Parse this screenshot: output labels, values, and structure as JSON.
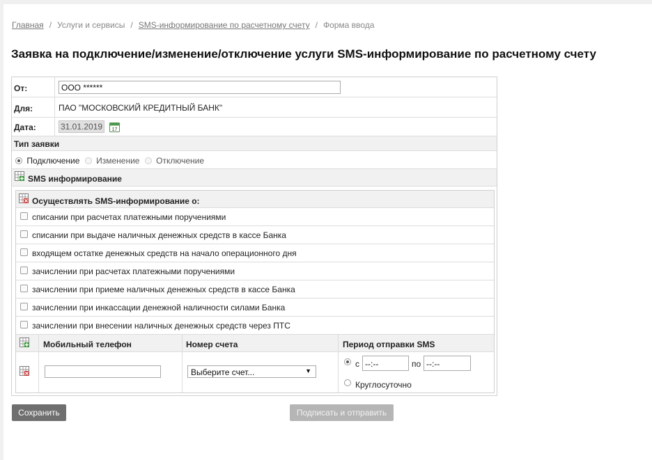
{
  "breadcrumb": {
    "home": "Главная",
    "services": "Услуги и сервисы",
    "sms": "SMS-информирование по расчетному счету",
    "current": "Форма ввода"
  },
  "title": "Заявка на подключение/изменение/отключение услуги SMS-информирование по расчетному счету",
  "from": {
    "label": "От:",
    "value": "ООО  ******"
  },
  "to": {
    "label": "Для:",
    "value": "ПАО \"МОСКОВСКИЙ КРЕДИТНЫЙ БАНК\""
  },
  "date": {
    "label": "Дата:",
    "value": "31.01.2019",
    "icon": "calendar-icon"
  },
  "request_type": {
    "heading": "Тип заявки",
    "options": [
      {
        "label": "Подключение",
        "selected": true
      },
      {
        "label": "Изменение",
        "selected": false
      },
      {
        "label": "Отключение",
        "selected": false
      }
    ]
  },
  "sms": {
    "heading": "SMS информирование",
    "notify_heading": "Осуществлять SMS-информирование о:",
    "options": [
      "списании при расчетах платежными поручениями",
      "списании при выдаче наличных денежных средств в кассе Банка",
      "входящем остатке денежных средств на начало операционного дня",
      "зачислении при расчетах платежными поручениями",
      "зачислении при приеме наличных денежных средств в кассе Банка",
      "зачислении при инкассации денежной наличности силами Банка",
      "зачислении при внесении наличных денежных средств через ПТС"
    ],
    "columns": {
      "phone": "Мобильный телефон",
      "account": "Номер счета",
      "period": "Период отправки SMS"
    },
    "row": {
      "phone_value": "",
      "account_placeholder": "Выберите счет...",
      "from_label": "с",
      "from_value": "--:--",
      "to_label": "по",
      "to_value": "--:--",
      "around_clock": "Круглосуточно"
    }
  },
  "buttons": {
    "save": "Сохранить",
    "sign": "Подписать и отправить"
  },
  "colors": {
    "save_button": "#6f6f6f",
    "sign_button_disabled": "#b5b5b5",
    "icon_green": "#3a9a3a",
    "icon_red": "#d03030"
  }
}
